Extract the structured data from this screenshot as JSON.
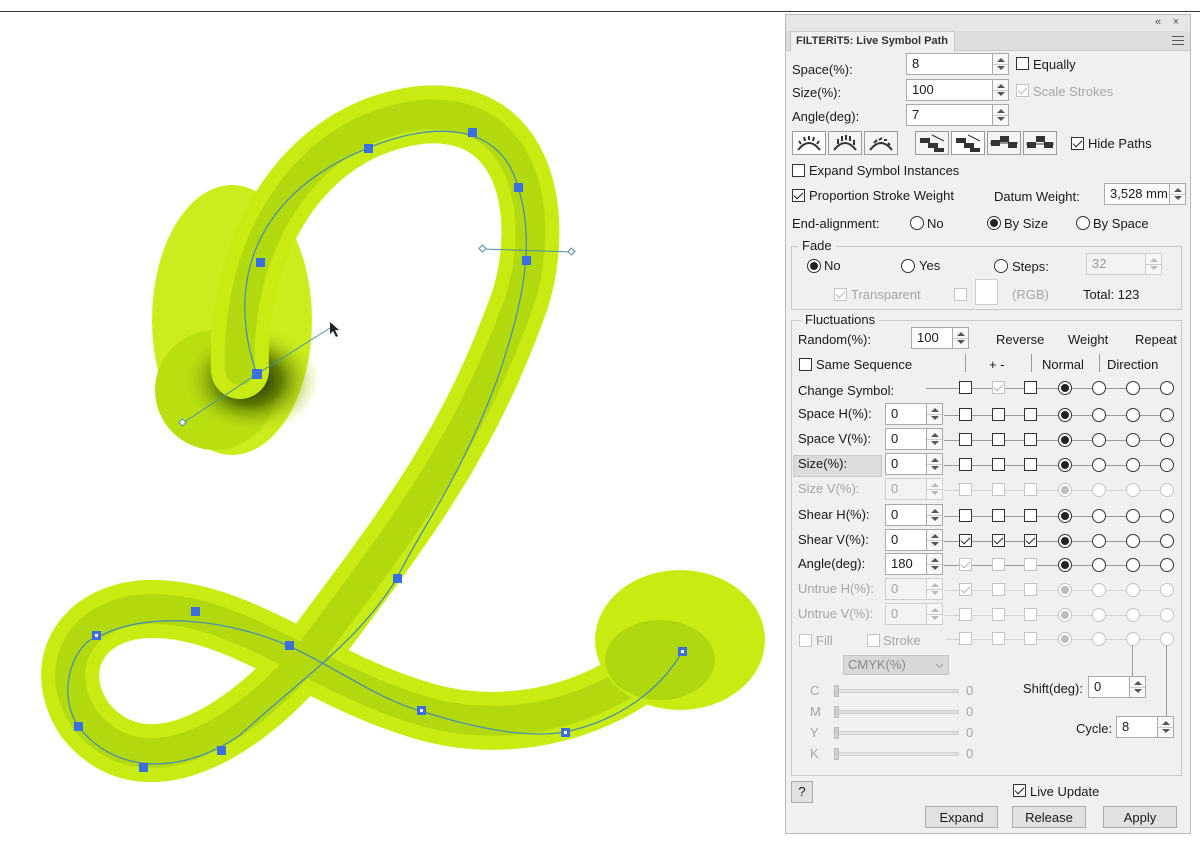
{
  "panel": {
    "title": "FILTERiT5: Live Symbol Path",
    "collapse_glyph": "«",
    "close_glyph": "×"
  },
  "main": {
    "space_label": "Space(%):",
    "space_value": "8",
    "size_label": "Size(%):",
    "size_value": "100",
    "angle_label": "Angle(deg):",
    "angle_value": "7",
    "equally_label": "Equally",
    "scale_strokes_label": "Scale Strokes",
    "hide_paths_label": "Hide Paths",
    "expand_instances_label": "Expand Symbol Instances",
    "proportion_label": "Proportion Stroke Weight",
    "datum_label": "Datum Weight:",
    "datum_value": "3,528 mm",
    "end_alignment_label": "End-alignment:",
    "end_no": "No",
    "end_by_size": "By Size",
    "end_by_space": "By Space"
  },
  "fade": {
    "title": "Fade",
    "no": "No",
    "yes": "Yes",
    "steps": "Steps:",
    "steps_value": "32",
    "transparent": "Transparent",
    "rgb": "(RGB)",
    "total": "Total: 123"
  },
  "fluct": {
    "title": "Fluctuations",
    "random_label": "Random(%):",
    "random_value": "100",
    "reverse": "Reverse",
    "weight": "Weight",
    "repeat": "Repeat",
    "same_sequence": "Same Sequence",
    "plus_minus": "+ -",
    "normal": "Normal",
    "direction": "Direction",
    "change_symbol": "Change Symbol:",
    "rows": [
      {
        "label": "Space H(%):",
        "value": "0"
      },
      {
        "label": "Space V(%):",
        "value": "0"
      },
      {
        "label": "Size(%):",
        "value": "0"
      },
      {
        "label": "Size V(%):",
        "value": "0"
      },
      {
        "label": "Shear H(%):",
        "value": "0"
      },
      {
        "label": "Shear V(%):",
        "value": "0"
      },
      {
        "label": "Angle(deg):",
        "value": "180"
      },
      {
        "label": "Untrue H(%):",
        "value": "0"
      },
      {
        "label": "Untrue V(%):",
        "value": "0"
      }
    ],
    "fill": "Fill",
    "stroke": "Stroke",
    "color_mode": "CMYK(%)",
    "cmyk": [
      {
        "label": "C",
        "value": "0"
      },
      {
        "label": "M",
        "value": "0"
      },
      {
        "label": "Y",
        "value": "0"
      },
      {
        "label": "K",
        "value": "0"
      }
    ],
    "shift_label": "Shift(deg):",
    "shift_value": "0",
    "cycle_label": "Cycle:",
    "cycle_value": "8"
  },
  "footer": {
    "help": "?",
    "live_update": "Live Update",
    "expand": "Expand",
    "release": "Release",
    "apply": "Apply"
  },
  "colors": {
    "foliage": "#c8ec12",
    "foliage_dark": "#8fb800",
    "path": "#4f8fa8",
    "anchor": "#3b6fe0"
  }
}
